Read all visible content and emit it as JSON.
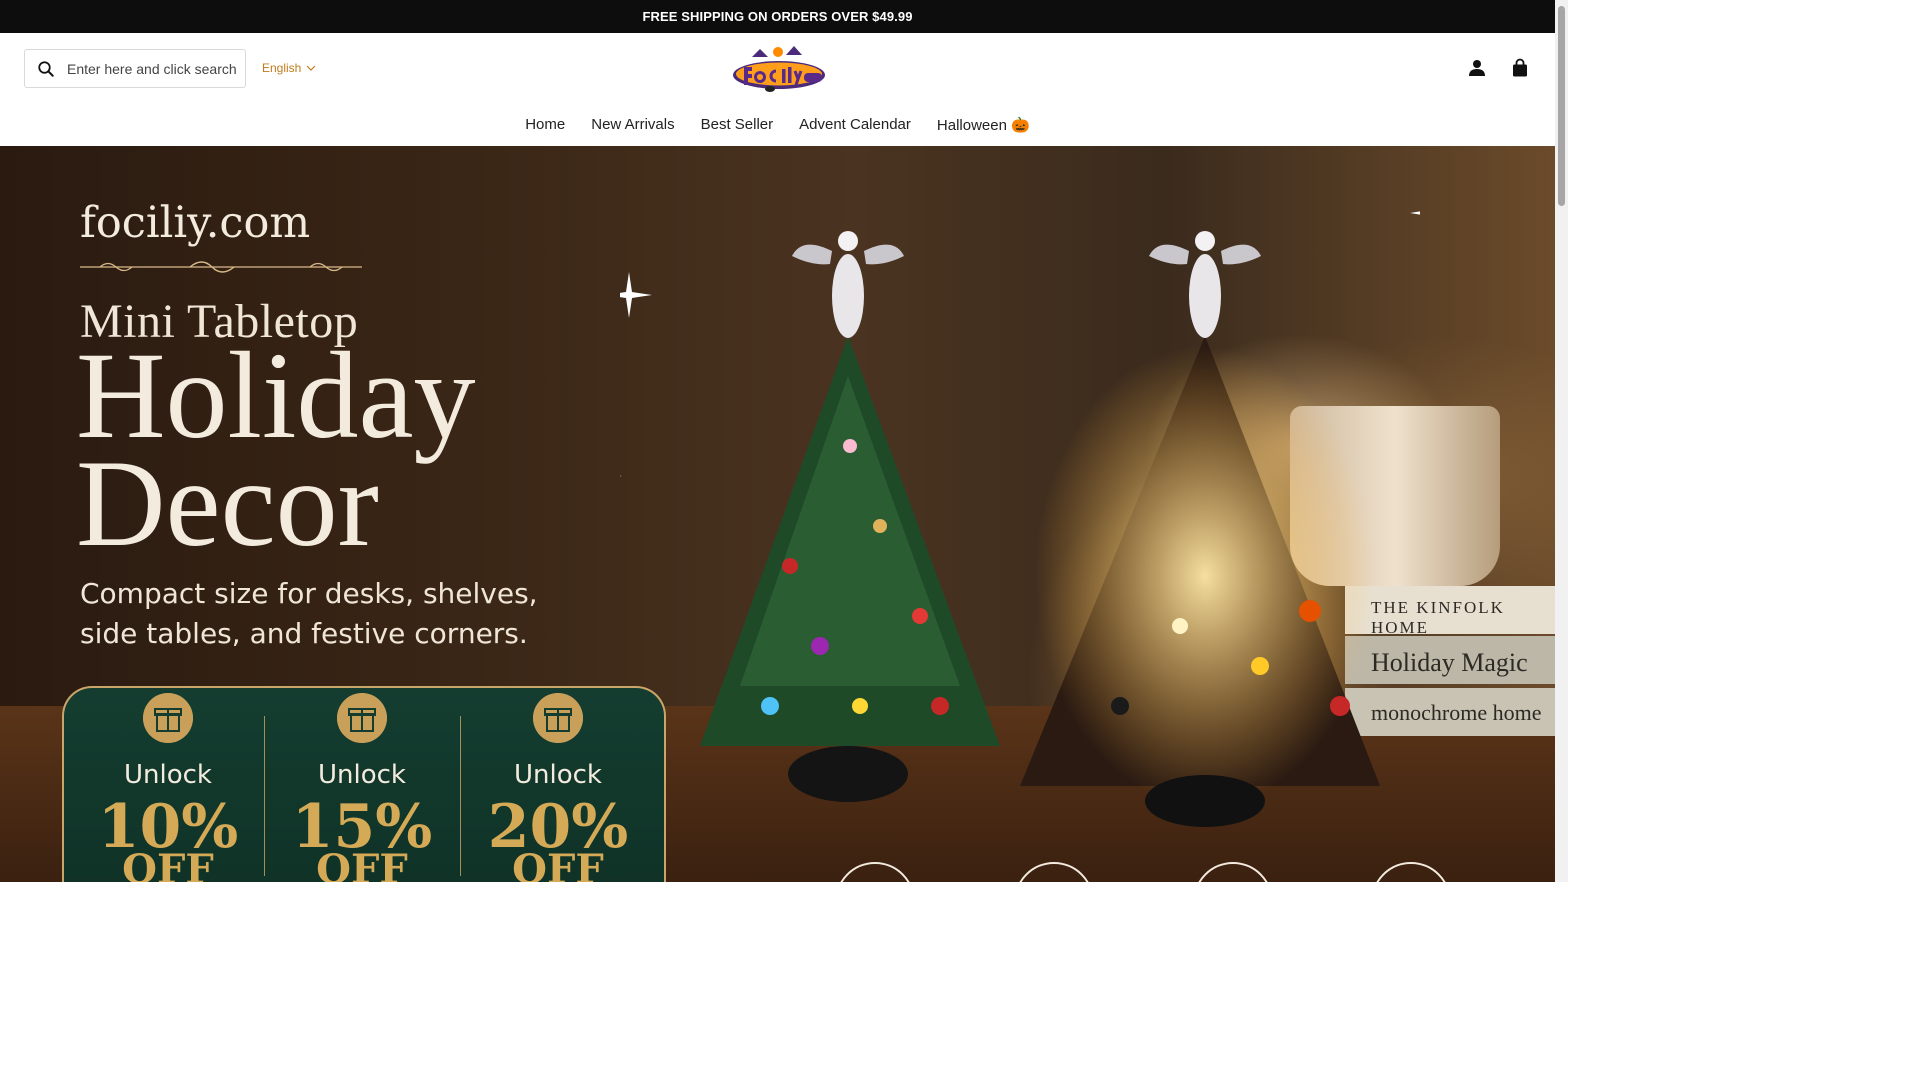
{
  "announcement": {
    "text": "FREE SHIPPING ON ORDERS OVER $49.99"
  },
  "header": {
    "search": {
      "placeholder": "Enter here and click search"
    },
    "language": {
      "selected": "English"
    },
    "logo_alt": "Fociliy.com",
    "icons": {
      "account": "user-icon",
      "cart": "bag-icon"
    }
  },
  "nav": {
    "items": [
      {
        "label": "Home"
      },
      {
        "label": "New Arrivals"
      },
      {
        "label": "Best Seller"
      },
      {
        "label": "Advent Calendar"
      },
      {
        "label": "Halloween 🎃"
      }
    ]
  },
  "hero": {
    "site": "fociliy.com",
    "subtitle": "Mini Tabletop",
    "headline_line1": "Holiday",
    "headline_line2": "Decor",
    "description": "Compact size for desks, shelves, side tables, and festive corners.",
    "coupons": [
      {
        "unlock": "Unlock",
        "percent": "10%",
        "off": "OFF"
      },
      {
        "unlock": "Unlock",
        "percent": "15%",
        "off": "OFF"
      },
      {
        "unlock": "Unlock",
        "percent": "20%",
        "off": "OFF"
      }
    ],
    "books": [
      "THE KINFOLK HOME",
      "Holiday Magic",
      "monochrome home"
    ]
  },
  "colors": {
    "announcement_bg": "#0d0d0d",
    "accent_gold": "#d5aa57",
    "language_text": "#c27b1d",
    "coupon_green": "#143d30"
  }
}
